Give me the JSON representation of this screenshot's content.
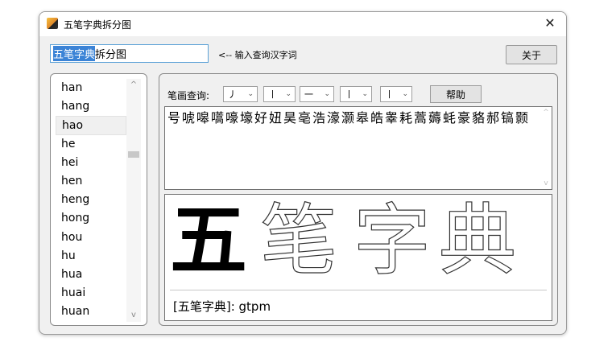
{
  "window": {
    "title": "五笔字典拆分图",
    "close_glyph": "✕"
  },
  "search": {
    "selected": "五笔字典",
    "rest": "拆分图",
    "hint": "<-- 输入查询汉字词",
    "about_label": "关于"
  },
  "pinyin_list": {
    "items": [
      "han",
      "hang",
      "hao",
      "he",
      "hei",
      "hen",
      "heng",
      "hong",
      "hou",
      "hu",
      "hua",
      "huai",
      "huan"
    ],
    "selected": "hao",
    "scroll_up": "^",
    "scroll_down": "v"
  },
  "stroke_query": {
    "label": "笔画查询:",
    "selects": [
      "丿",
      "丨",
      "一",
      "丨",
      "丨"
    ],
    "help_label": "帮助"
  },
  "results": {
    "text": "号唬嗥嚆嚎壕好妞昊亳浩濠灏皋皓睾耗蒿薅蚝豪貉郝镐颢",
    "scroll_up": "^",
    "scroll_down": "v"
  },
  "display": {
    "chars": [
      "五",
      "笔",
      "字",
      "典"
    ],
    "code_line": "[五笔字典]: gtpm"
  },
  "icons": {
    "app": "app-icon",
    "close": "close-icon",
    "dropdown": "chevron-down-icon"
  }
}
